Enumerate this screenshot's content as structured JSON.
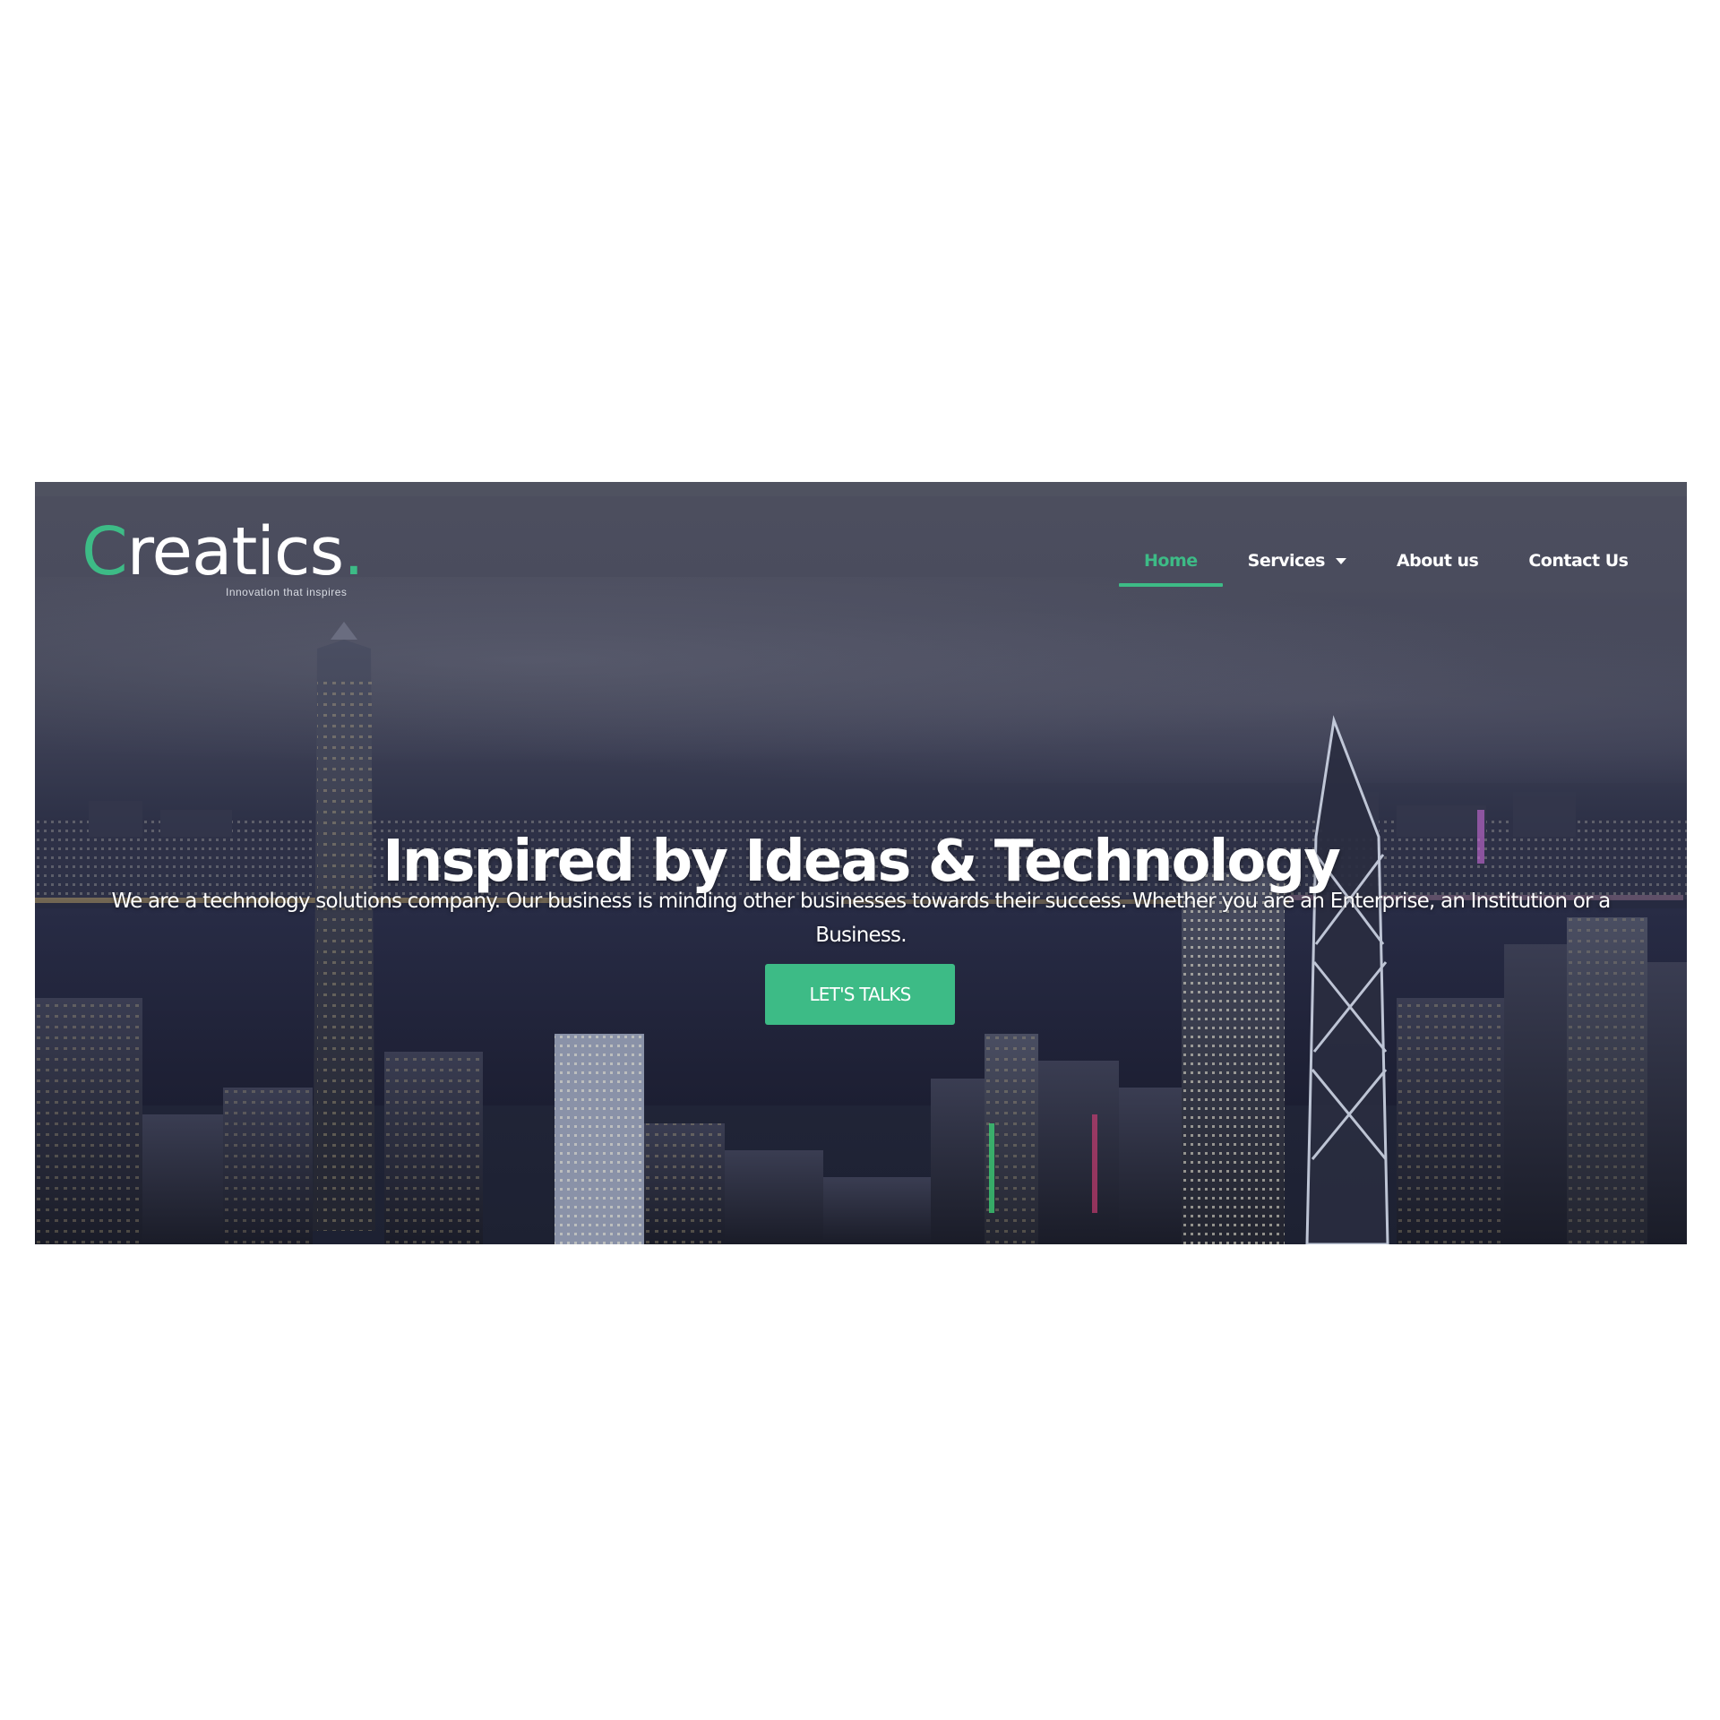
{
  "brand": {
    "name_first": "C",
    "name_rest": "reatics",
    "dot": ".",
    "tagline": "Innovation that inspires",
    "accent_color": "#3dbb86"
  },
  "nav": {
    "items": [
      {
        "label": "Home",
        "active": true
      },
      {
        "label": "Services",
        "has_dropdown": true
      },
      {
        "label": "About us"
      },
      {
        "label": "Contact Us"
      }
    ]
  },
  "hero": {
    "headline": "Inspired by Ideas & Technology",
    "subtext": "We are a technology solutions company. Our business is minding other businesses towards their success. Whether you are an Enterprise, an Institution or a Business.",
    "cta_label": "LET'S TALKS",
    "background": "night city skyline"
  }
}
